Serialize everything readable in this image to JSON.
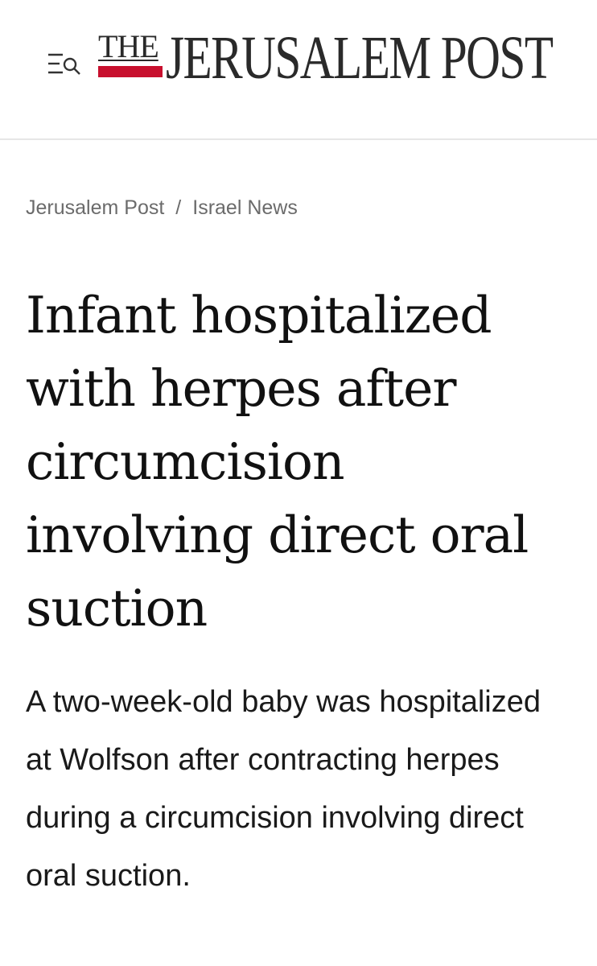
{
  "header": {
    "menu_icon": "menu-search-icon",
    "logo": {
      "the": "THE",
      "name": "JERUSALEM POST",
      "accent_color": "#c8102e"
    }
  },
  "breadcrumb": {
    "items": [
      "Jerusalem Post",
      "Israel News"
    ],
    "separator": "/"
  },
  "article": {
    "headline": "Infant hospitalized with herpes after circumcision involving direct oral suction",
    "subheadline": "A two-week-old baby was hospitalized at Wolfson after contracting herpes during a circumcision involving direct oral suction."
  }
}
